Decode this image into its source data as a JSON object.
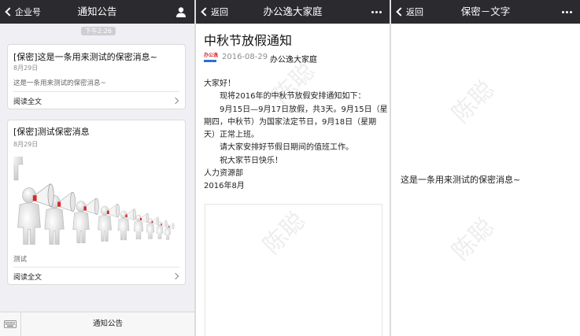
{
  "panel1": {
    "nav": {
      "back_label": "企业号",
      "title": "通知公告"
    },
    "timestamp": "下午2:26",
    "cards": [
      {
        "title": "[保密]这是一条用来测试的保密消息~",
        "date": "8月29日",
        "description": "这是一条用来测试的保密消息~",
        "read_more": "阅读全文"
      },
      {
        "title": "[保密]测试保密消息",
        "date": "8月29日",
        "description": "测试",
        "read_more": "阅读全文"
      }
    ],
    "bottom_menu_label": "通知公告"
  },
  "panel2": {
    "nav": {
      "back_label": "返回",
      "title": "办公逸大家庭"
    },
    "article": {
      "title": "中秋节放假通知",
      "logo_text": "办公逸",
      "date": "2016-08-29",
      "author": "办公逸大家庭",
      "lines": [
        "大家好！",
        "现将2016年的中秋节放假安排通知如下：",
        "9月15日—9月17日放假，共3天。9月15日（星",
        "期四，中秋节）为国家法定节日，9月18日（星期",
        "天）正常上班。",
        "请大家安排好节假日期间的值班工作。",
        "祝大家节日快乐！",
        "人力资源部",
        "2016年8月"
      ]
    },
    "watermark": "陈聪"
  },
  "panel3": {
    "nav": {
      "back_label": "返回",
      "title": "保密－文字"
    },
    "message": "这是一条用来测试的保密消息~",
    "watermark": "陈聪"
  },
  "colors": {
    "navbar": "#2b2b2f",
    "list_background": "#efeff4",
    "accent_red": "#d9262c"
  },
  "icons": [
    "chevron-left-icon",
    "person-icon",
    "more-dots-icon",
    "chevron-right-icon",
    "keyboard-icon"
  ]
}
